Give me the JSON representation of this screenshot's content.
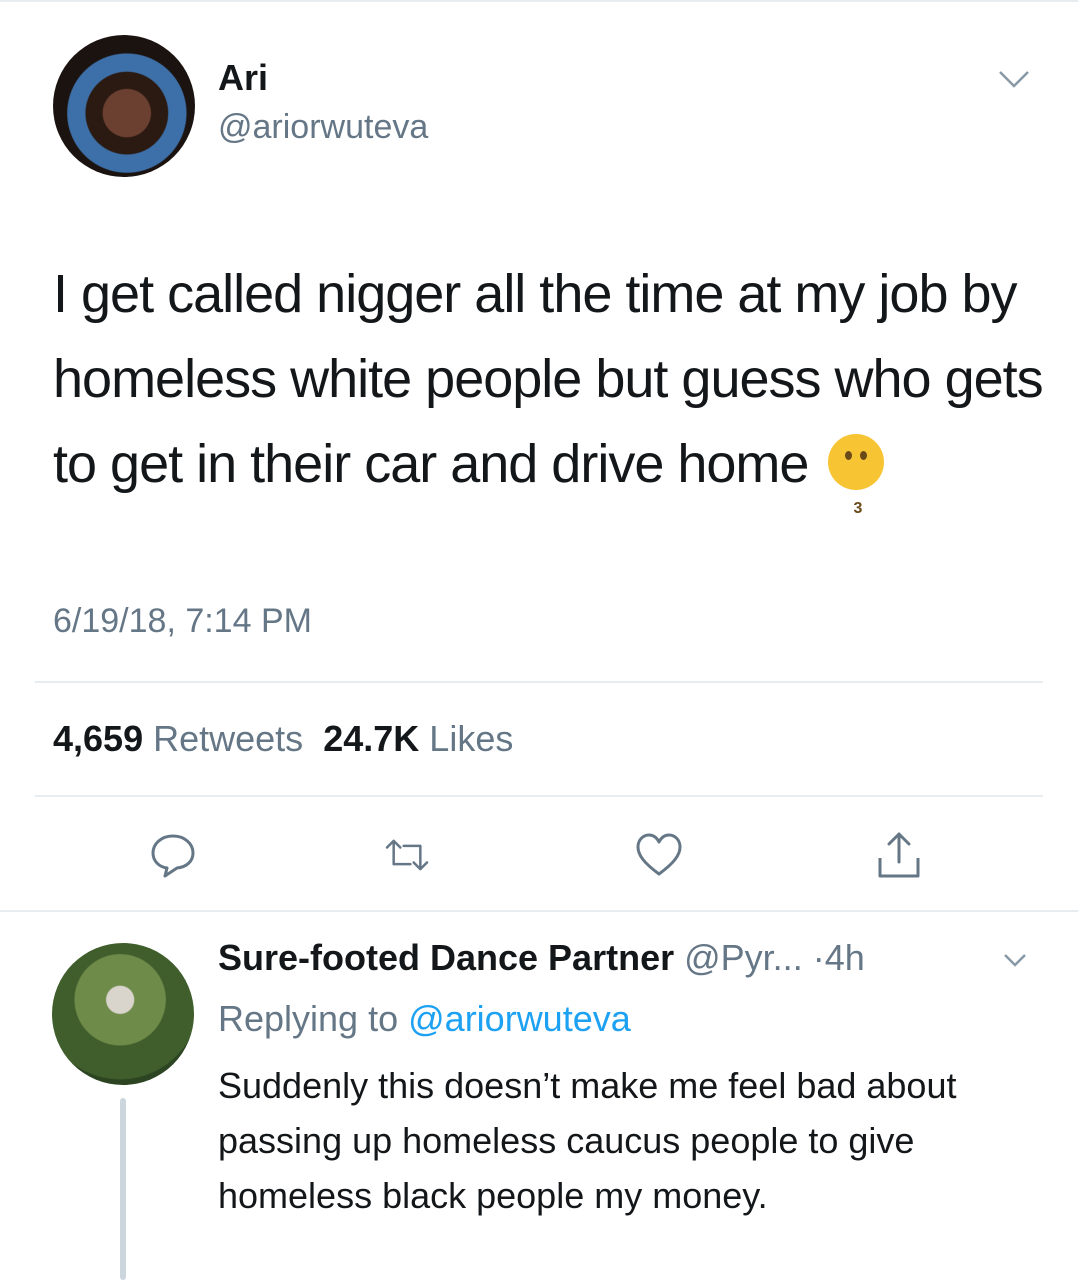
{
  "tweet": {
    "author_name": "Ari",
    "author_handle": "@ariorwuteva",
    "text": "I get called nigger all the time at my job by homeless white people but guess who gets to get in their car and drive home",
    "emoji": "kissing-face",
    "timestamp": "6/19/18, 7:14 PM",
    "retweets_count": "4,659",
    "retweets_label": "Retweets",
    "likes_count": "24.7K",
    "likes_label": "Likes"
  },
  "reply": {
    "author_name": "Sure-footed Dance Partner",
    "author_handle": "@Pyr...",
    "time": "·4h",
    "replying_prefix": "Replying to",
    "replying_handle": "@ariorwuteva",
    "text": "Suddenly this doesn’t make me feel bad about passing up homeless caucus people to give homeless black people my money."
  },
  "actions": [
    "reply-icon",
    "retweet-icon",
    "like-icon",
    "share-icon"
  ],
  "colors": {
    "link": "#1da1f2",
    "secondary": "#657786",
    "divider": "#e6ecf0"
  }
}
